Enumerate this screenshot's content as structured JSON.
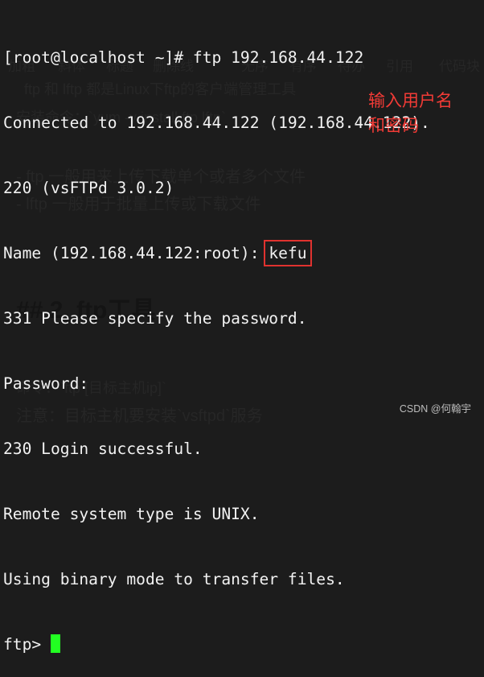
{
  "background_editor": {
    "toolbar": [
      "加粗",
      "斜体",
      "标题",
      "删除线",
      "无序",
      "有序",
      "待办",
      "引用",
      "代码块"
    ],
    "lines": [
      "ftp 和 lftp 都是Linux下ftp的客户端管理工具",
      "安装命令：`yum -y install ftp lftp`",
      "- ftp 一般用来上传下载单个或者多个文件",
      "- lftp 一般用于批量上传或下载文件"
    ],
    "heading": "## 2. ftp工具",
    "command_line": "命令：`ftp [目标主机ip]`",
    "note_line": "注意：目标主机要安装`vsftpd`服务"
  },
  "terminal": {
    "lines": [
      "[root@localhost ~]# ftp 192.168.44.122",
      "Connected to 192.168.44.122 (192.168.44.122).",
      "220 (vsFTPd 3.0.2)",
      "Name (192.168.44.122:root): ",
      "331 Please specify the password.",
      "Password:",
      "230 Login successful.",
      "Remote system type is UNIX.",
      "Using binary mode to transfer files."
    ],
    "username_input": "kefu",
    "prompt": "ftp> ",
    "cursor_color": "#22ff22"
  },
  "annotation": {
    "line1": "输入用户名",
    "line2": "和密码",
    "color": "#f23b36"
  },
  "watermark": "CSDN @何翰宇"
}
